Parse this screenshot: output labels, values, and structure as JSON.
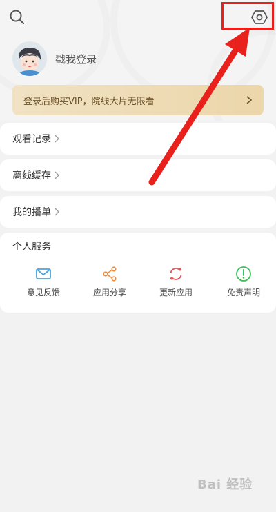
{
  "header": {
    "search_icon": "search-icon",
    "settings_icon": "settings-icon"
  },
  "profile": {
    "login_text": "戳我登录"
  },
  "vip_banner": {
    "text": "登录后购买VIP，院线大片无限看"
  },
  "menu": [
    {
      "label": "观看记录"
    },
    {
      "label": "离线缓存"
    },
    {
      "label": "我的播单"
    }
  ],
  "services": {
    "title": "个人服务",
    "items": [
      {
        "label": "意见反馈",
        "icon": "mail-icon",
        "color": "#4aa3df"
      },
      {
        "label": "应用分享",
        "icon": "share-icon",
        "color": "#f08a3c"
      },
      {
        "label": "更新应用",
        "icon": "refresh-icon",
        "color": "#e8565a"
      },
      {
        "label": "免责声明",
        "icon": "exclamation-icon",
        "color": "#3bbf5a"
      }
    ]
  },
  "watermark": "Bai 经验",
  "colors": {
    "annotation_red": "#e8211c",
    "vip_gold": "#ecd6aa",
    "background": "#f2f2f2"
  }
}
